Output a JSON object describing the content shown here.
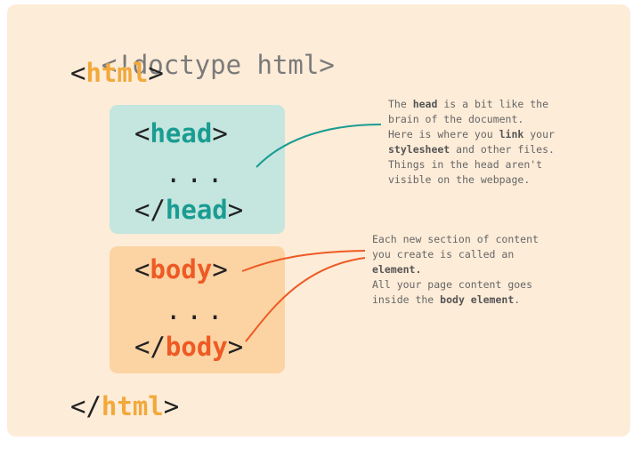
{
  "code": {
    "doctype": "<!doctype html>",
    "html_open_tag": "html",
    "head_open_tag": "head",
    "head_dots": "...",
    "head_close_tag": "head",
    "body_open_tag": "body",
    "body_dots": "...",
    "body_close_tag": "body",
    "html_close_tag": "html",
    "open_bracket": "<",
    "close_bracket": ">",
    "close_open_bracket": "</"
  },
  "notes": {
    "head": {
      "line1_pre": "The ",
      "line1_bold": "head",
      "line1_post": " is a bit like the",
      "line2": "brain of the document.",
      "line3_pre": "Here is where you ",
      "line3_bold": "link",
      "line3_post": " your",
      "line4_bold": "stylesheet",
      "line4_post": " and other files.",
      "line5": "Things in the head aren't",
      "line6": "visible on the webpage."
    },
    "body": {
      "line1": "Each new section of content",
      "line2": "you create is called an",
      "line3_bold": "element.",
      "line4": "All your page content goes",
      "line5_pre": "inside the ",
      "line5_bold": "body element",
      "line5_post": "."
    }
  },
  "colors": {
    "background": "#fdecd8",
    "html_tag": "#f2a93b",
    "head_tag": "#1a9c92",
    "head_box": "#c4e6df",
    "body_tag": "#ee5a24",
    "body_box": "#fcd3a3",
    "doctype": "#7a7a7a"
  }
}
